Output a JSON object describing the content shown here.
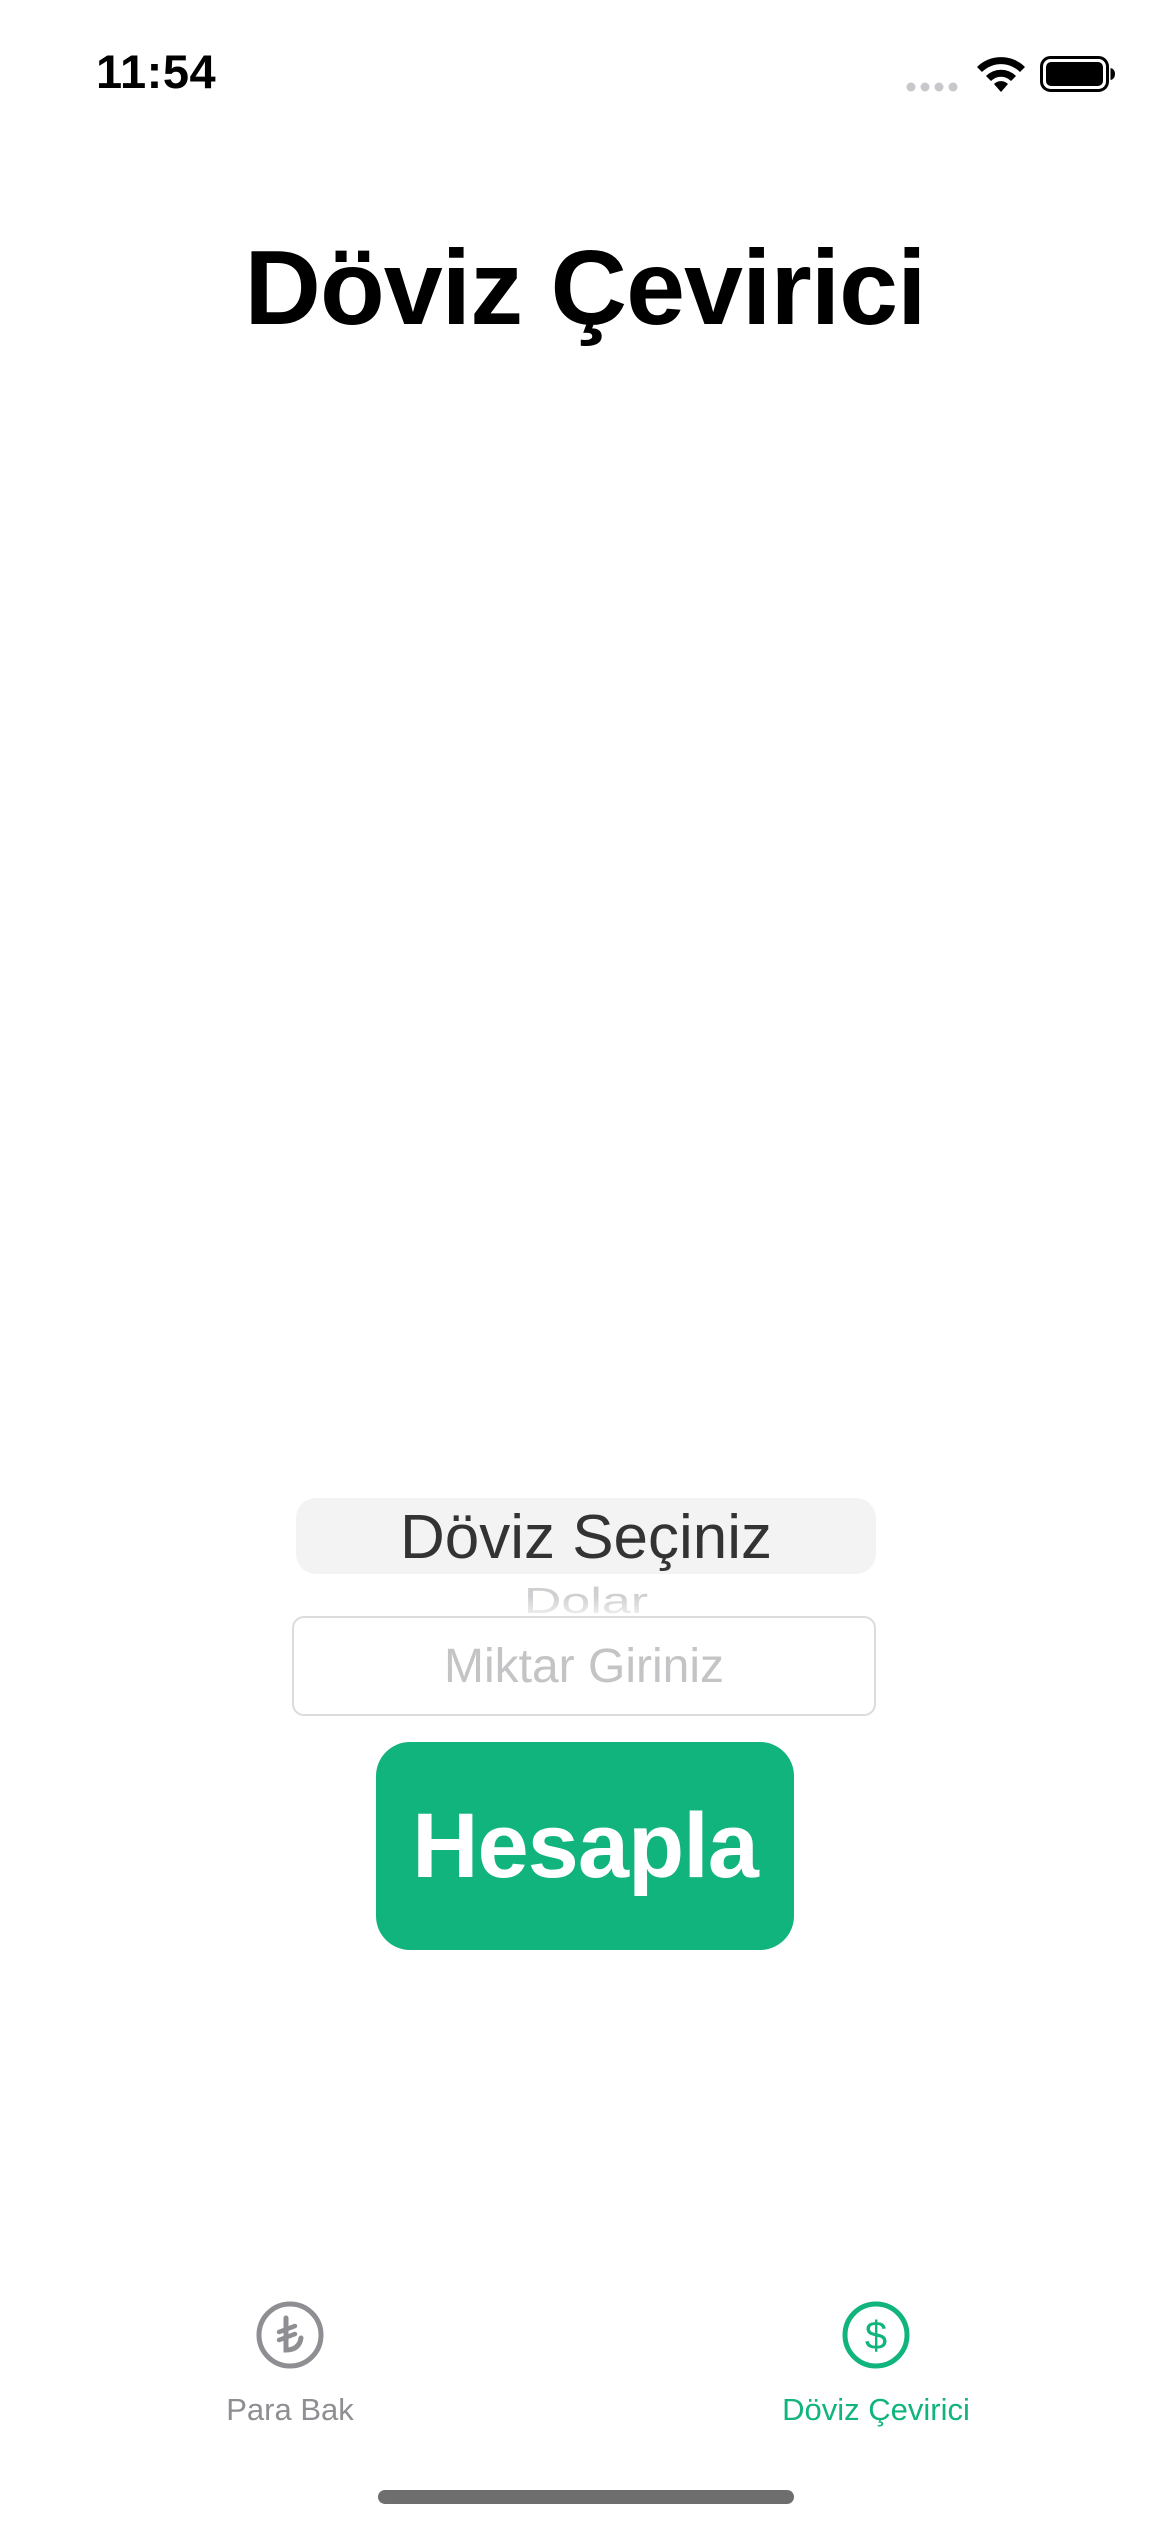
{
  "status_bar": {
    "time": "11:54"
  },
  "title": "Döviz Çevirici",
  "picker": {
    "selected": "Döviz Seçiniz",
    "next_option": "Dolar"
  },
  "amount_input": {
    "placeholder": "Miktar Giriniz",
    "value": ""
  },
  "calculate_button": {
    "label": "Hesapla",
    "color": "#10b47c"
  },
  "tab_bar": {
    "tabs": [
      {
        "label": "Para Bak",
        "icon": "lira-circle-icon",
        "active": false,
        "color": "#8e8e93"
      },
      {
        "label": "Döviz Çevirici",
        "icon": "dollar-circle-icon",
        "active": true,
        "color": "#10b47c"
      }
    ]
  }
}
